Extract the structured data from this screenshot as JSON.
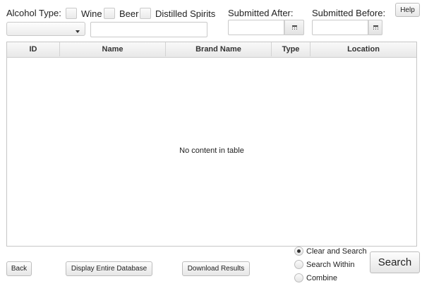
{
  "filters": {
    "alcohol_type_label": "Alcohol Type:",
    "options": [
      {
        "label": "Wine",
        "checked": false
      },
      {
        "label": "Beer",
        "checked": false
      },
      {
        "label": "Distilled Spirits",
        "checked": false
      }
    ],
    "combo_value": "",
    "search_value": "",
    "submitted_after_label": "Submitted After:",
    "submitted_after_value": "",
    "submitted_before_label": "Submitted Before:",
    "submitted_before_value": "",
    "calendar_icon": "calendar-icon"
  },
  "help_label": "Help",
  "table": {
    "columns": [
      "ID",
      "Name",
      "Brand Name",
      "Type",
      "Location"
    ],
    "rows": [],
    "empty_text": "No content in table"
  },
  "footer": {
    "back_label": "Back",
    "display_all_label": "Display Entire Database",
    "download_label": "Download Results",
    "search_label": "Search",
    "modes": [
      {
        "label": "Clear and Search",
        "selected": true
      },
      {
        "label": "Search Within",
        "selected": false
      },
      {
        "label": "Combine",
        "selected": false
      }
    ]
  }
}
